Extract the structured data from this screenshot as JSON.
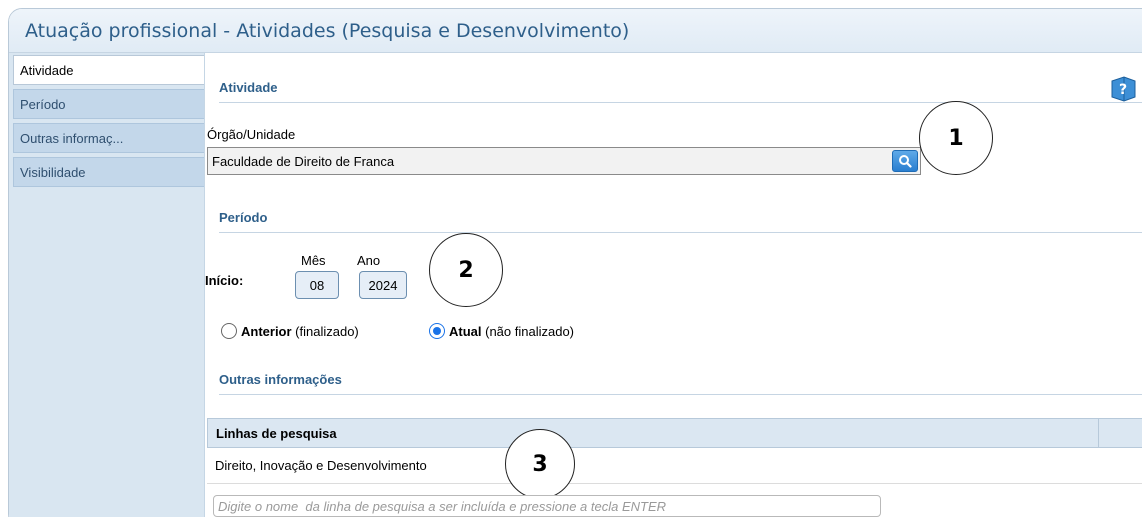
{
  "window": {
    "title": "Atuação profissional - Atividades (Pesquisa e Desenvolvimento)"
  },
  "tabs": [
    {
      "label": "Atividade"
    },
    {
      "label": "Período"
    },
    {
      "label": "Outras informaç..."
    },
    {
      "label": "Visibilidade"
    }
  ],
  "atividade": {
    "section_title": "Atividade",
    "orgao_label": "Órgão/Unidade",
    "orgao_value": "Faculdade de Direito de Franca"
  },
  "periodo": {
    "section_title": "Período",
    "inicio_label": "Início:",
    "mes_label": "Mês",
    "ano_label": "Ano",
    "mes_value": "08",
    "ano_value": "2024",
    "anterior_bold": "Anterior",
    "anterior_rest": " (finalizado)",
    "atual_bold": "Atual",
    "atual_rest": " (não finalizado)",
    "selected": "atual"
  },
  "outras": {
    "section_title": "Outras informações",
    "table_header": "Linhas de pesquisa",
    "rows": [
      "Direito, Inovação e Desenvolvimento"
    ],
    "input_placeholder": "Digite o nome  da linha de pesquisa a ser incluída e pressione a tecla ENTER"
  },
  "callouts": [
    "1",
    "2",
    "3"
  ],
  "icons": {
    "help": "help-book-icon",
    "search": "search-icon"
  },
  "colors": {
    "accent": "#2e5f8a",
    "search_button": "#2a7fd0",
    "radio_selected": "#1a73e8"
  }
}
